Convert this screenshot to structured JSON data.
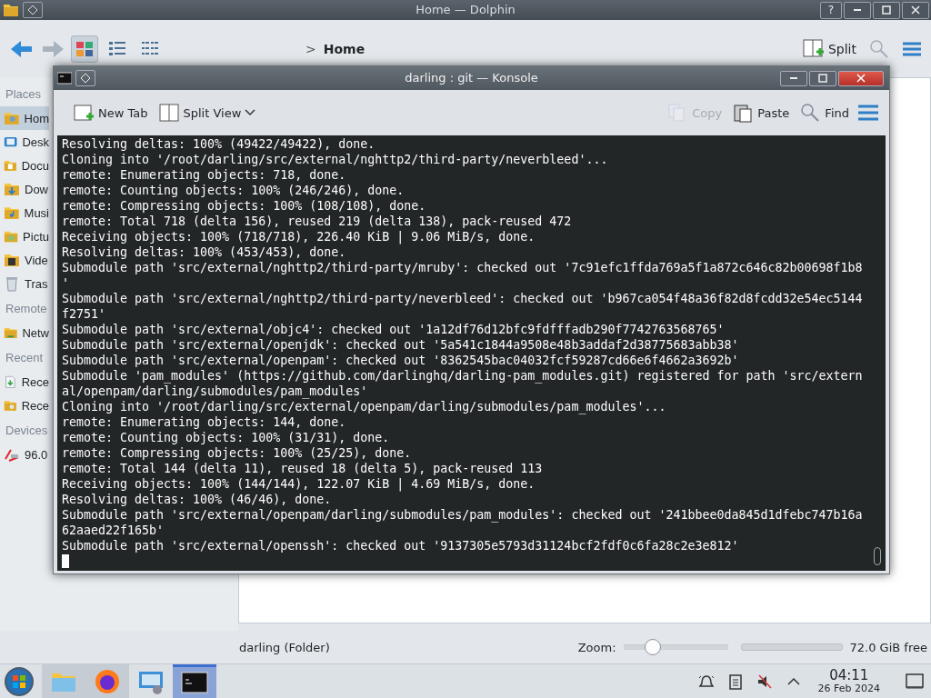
{
  "dolphin": {
    "title": "Home — Dolphin",
    "help_button": "?",
    "breadcrumb_separator": ">",
    "breadcrumb": "Home",
    "view_modes": [
      {
        "kind": "icons",
        "selected": true
      },
      {
        "kind": "details",
        "selected": false
      },
      {
        "kind": "compact",
        "selected": false
      }
    ],
    "split_label": "Split",
    "sidebar": [
      {
        "heading": "Places",
        "items": [
          {
            "label": "Hom",
            "kind": "home",
            "selected": true
          },
          {
            "label": "Desk",
            "kind": "desktop",
            "selected": false
          },
          {
            "label": "Docu",
            "kind": "documents",
            "selected": false
          },
          {
            "label": "Dow",
            "kind": "downloads",
            "selected": false
          },
          {
            "label": "Musi",
            "kind": "music",
            "selected": false
          },
          {
            "label": "Pictu",
            "kind": "pictures",
            "selected": false
          },
          {
            "label": "Vide",
            "kind": "videos",
            "selected": false
          },
          {
            "label": "Tras",
            "kind": "trash",
            "selected": false
          }
        ]
      },
      {
        "heading": "Remote",
        "items": [
          {
            "label": "Netw",
            "kind": "network",
            "selected": false
          }
        ]
      },
      {
        "heading": "Recent",
        "items": [
          {
            "label": "Rece",
            "kind": "recent-files",
            "selected": false
          },
          {
            "label": "Rece",
            "kind": "recent-locations",
            "selected": false
          }
        ]
      },
      {
        "heading": "Devices",
        "items": [
          {
            "label": "96.0",
            "kind": "drive",
            "selected": false
          }
        ]
      }
    ],
    "status": "darling (Folder)",
    "zoom_label": "Zoom:",
    "zoom": {
      "level": 0.28
    },
    "free_space": "72.0 GiB free"
  },
  "konsole": {
    "title": "darling : git — Konsole",
    "toolbar": [
      {
        "label": "New Tab",
        "kind": "new-tab",
        "disabled": false
      },
      {
        "label": "Split View",
        "kind": "split-view",
        "disabled": false
      },
      {
        "label": "Copy",
        "kind": "copy",
        "disabled": true
      },
      {
        "label": "Paste",
        "kind": "paste",
        "disabled": false
      },
      {
        "label": "Find",
        "kind": "find",
        "disabled": false
      }
    ],
    "lines": [
      "Resolving deltas: 100% (49422/49422), done.",
      "Cloning into '/root/darling/src/external/nghttp2/third-party/neverbleed'...",
      "remote: Enumerating objects: 718, done.",
      "remote: Counting objects: 100% (246/246), done.",
      "remote: Compressing objects: 100% (108/108), done.",
      "remote: Total 718 (delta 156), reused 219 (delta 138), pack-reused 472",
      "Receiving objects: 100% (718/718), 226.40 KiB | 9.06 MiB/s, done.",
      "Resolving deltas: 100% (453/453), done.",
      "Submodule path 'src/external/nghttp2/third-party/mruby': checked out '7c91efc1ffda769a5f1a872c646c82b00698f1b8",
      "'",
      "Submodule path 'src/external/nghttp2/third-party/neverbleed': checked out 'b967ca054f48a36f82d8fcdd32e54ec5144",
      "f2751'",
      "Submodule path 'src/external/objc4': checked out '1a12df76d12bfc9fdfffadb290f7742763568765'",
      "Submodule path 'src/external/openjdk': checked out '5a541c1844a9508e48b3addaf2d38775683abb38'",
      "Submodule path 'src/external/openpam': checked out '8362545bac04032fcf59287cd66e6f4662a3692b'",
      "Submodule 'pam_modules' (https://github.com/darlinghq/darling-pam_modules.git) registered for path 'src/extern",
      "al/openpam/darling/submodules/pam_modules'",
      "Cloning into '/root/darling/src/external/openpam/darling/submodules/pam_modules'...",
      "remote: Enumerating objects: 144, done.",
      "remote: Counting objects: 100% (31/31), done.",
      "remote: Compressing objects: 100% (25/25), done.",
      "remote: Total 144 (delta 11), reused 18 (delta 5), pack-reused 113",
      "Receiving objects: 100% (144/144), 122.07 KiB | 4.69 MiB/s, done.",
      "Resolving deltas: 100% (46/46), done.",
      "Submodule path 'src/external/openpam/darling/submodules/pam_modules': checked out '241bbee0da845d1dfebc747b16a",
      "62aaed22f165b'",
      "Submodule path 'src/external/openssh': checked out '9137305e5793d31124bcf2fdf0c6fa28c2e3e812'"
    ]
  },
  "taskbar": {
    "apps": [
      {
        "kind": "folder",
        "running": true,
        "selected": false
      },
      {
        "kind": "browser",
        "running": true,
        "selected": false
      },
      {
        "kind": "settings",
        "running": false,
        "selected": false
      },
      {
        "kind": "terminal",
        "running": true,
        "selected": true
      }
    ],
    "tray": [
      {
        "kind": "notifications"
      },
      {
        "kind": "clipboard"
      },
      {
        "kind": "volume-muted"
      },
      {
        "kind": "expand"
      }
    ],
    "time": "04:11",
    "date": "26 Feb 2024"
  }
}
